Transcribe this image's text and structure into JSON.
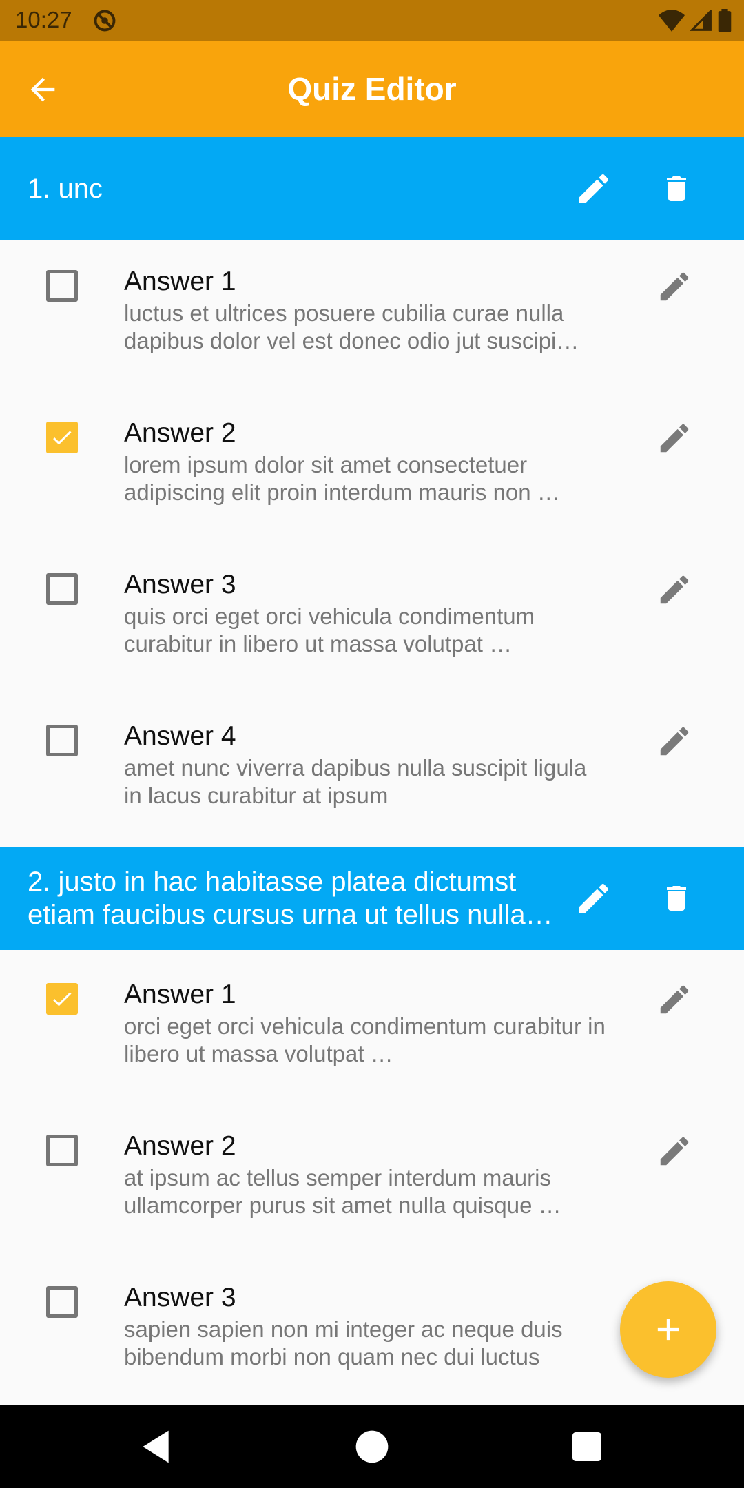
{
  "status_bar": {
    "time": "10:27"
  },
  "app_bar": {
    "title": "Quiz Editor"
  },
  "questions": [
    {
      "title": "1. unc",
      "answers": [
        {
          "label": "Answer 1",
          "text": "luctus et ultrices posuere cubilia curae nulla dapibus dolor vel est donec odio jut suscipi…",
          "checked": false
        },
        {
          "label": "Answer 2",
          "text": "lorem ipsum dolor sit amet consectetuer adipiscing elit proin interdum mauris non …",
          "checked": true
        },
        {
          "label": "Answer 3",
          "text": "quis orci eget orci vehicula condimentum curabitur in libero ut massa volutpat …",
          "checked": false
        },
        {
          "label": "Answer 4",
          "text": "amet nunc viverra dapibus nulla suscipit ligula in lacus curabitur at ipsum",
          "checked": false
        }
      ]
    },
    {
      "title": "2. justo in hac habitasse platea dictumst etiam faucibus cursus urna ut tellus nulla…",
      "answers": [
        {
          "label": "Answer 1",
          "text": "orci eget orci vehicula condimentum curabitur in libero ut massa volutpat …",
          "checked": true
        },
        {
          "label": "Answer 2",
          "text": "at ipsum ac tellus semper interdum mauris ullamcorper purus sit amet nulla quisque …",
          "checked": false
        },
        {
          "label": "Answer 3",
          "text": "sapien sapien non mi integer ac neque duis bibendum morbi non quam nec dui luctus",
          "checked": false
        }
      ]
    }
  ],
  "icons": {
    "back": "arrow-left-icon",
    "edit": "pencil-icon",
    "delete": "trash-icon",
    "add": "plus-icon",
    "checkbox_checked": "check-icon"
  },
  "colors": {
    "status_bar": "#b97805",
    "app_bar": "#f9a40c",
    "question_header": "#03a9f4",
    "accent": "#fbc02d"
  }
}
